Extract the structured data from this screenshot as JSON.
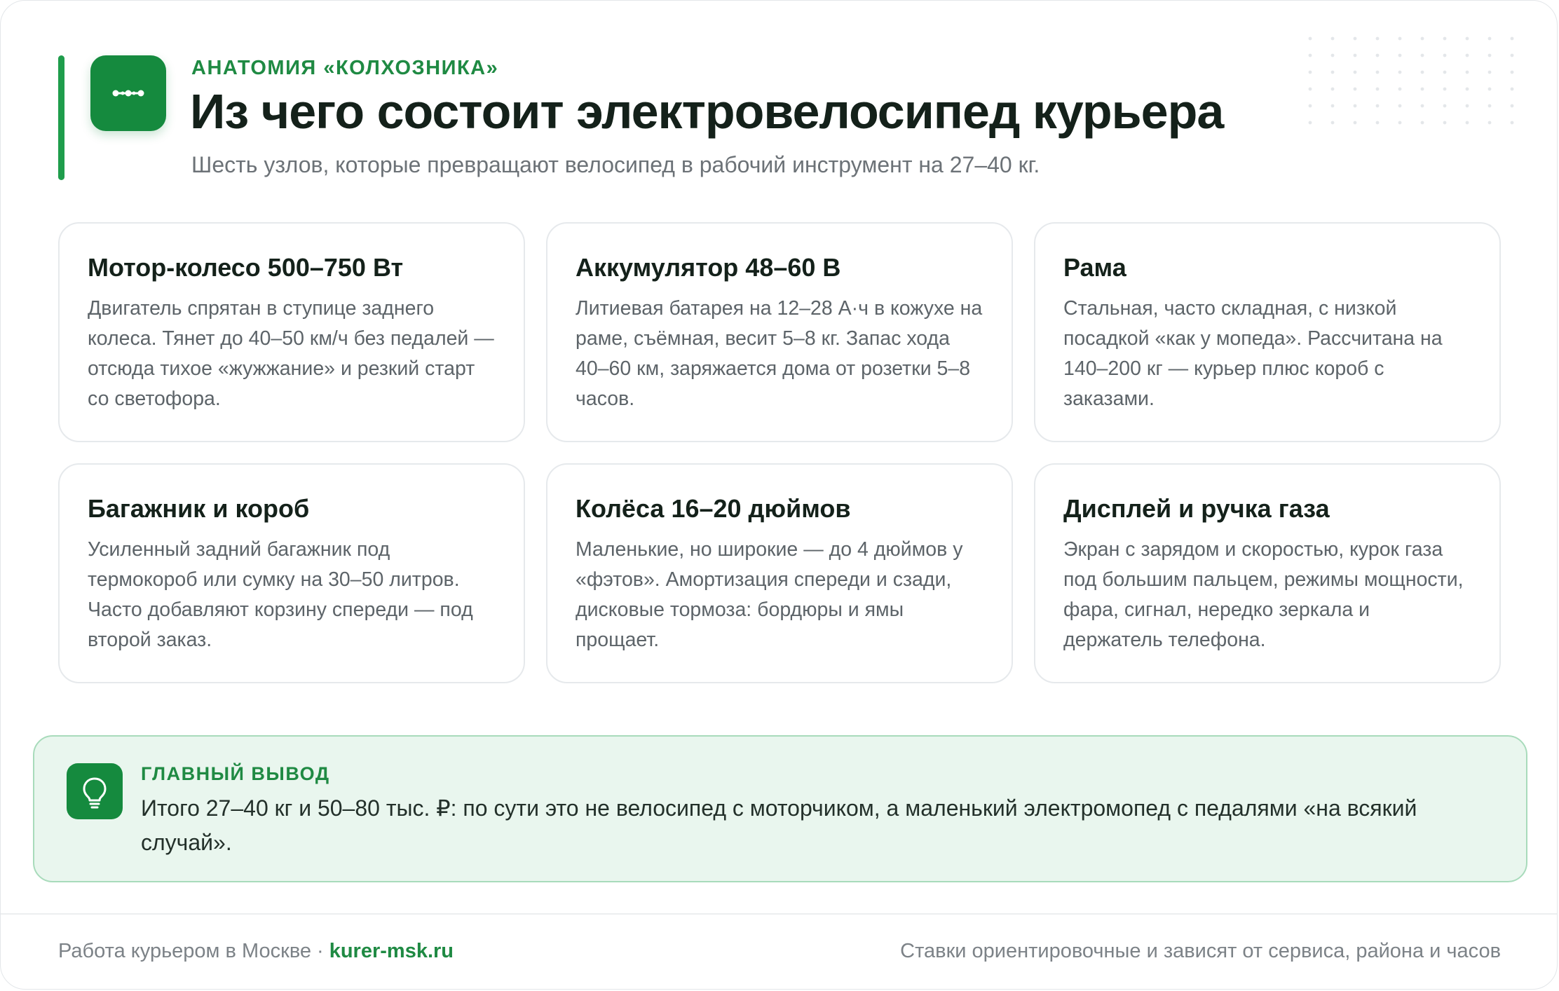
{
  "header": {
    "eyebrow": "АНАТОМИЯ «КОЛХОЗНИКА»",
    "title": "Из чего состоит электровелосипед курьера",
    "subtitle": "Шесть узлов, которые превращают велосипед в рабочий инструмент на 27–40 кг.",
    "logo_icon": "connection-dots-icon"
  },
  "cards": [
    {
      "title": "Мотор-колесо 500–750 Вт",
      "text": "Двигатель спрятан в ступице заднего колеса. Тянет до 40–50 км/ч без педалей — отсюда тихое «жужжание» и резкий старт со светофора."
    },
    {
      "title": "Аккумулятор 48–60 В",
      "text": "Литиевая батарея на 12–28 А·ч в кожухе на раме, съёмная, весит 5–8 кг. Запас хода 40–60 км, заряжается дома от розетки 5–8 часов."
    },
    {
      "title": "Рама",
      "text": "Стальная, часто складная, с низкой посадкой «как у мопеда». Рассчитана на 140–200 кг — курьер плюс короб с заказами."
    },
    {
      "title": "Багажник и короб",
      "text": "Усиленный задний багажник под термокороб или сумку на 30–50 литров. Часто добавляют корзину спереди — под второй заказ."
    },
    {
      "title": "Колёса 16–20 дюймов",
      "text": "Маленькие, но широкие — до 4 дюймов у «фэтов». Амортизация спереди и сзади, дисковые тормоза: бордюры и ямы прощает."
    },
    {
      "title": "Дисплей и ручка газа",
      "text": "Экран с зарядом и скоростью, курок газа под большим пальцем, режимы мощности, фара, сигнал, нередко зеркала и держатель телефона."
    }
  ],
  "callout": {
    "label": "ГЛАВНЫЙ ВЫВОД",
    "text": "Итого 27–40 кг и 50–80 тыс. ₽: по сути это не велосипед с моторчиком, а маленький электромопед с педалями «на всякий случай».",
    "icon": "lightbulb-icon"
  },
  "footer": {
    "left_text": "Работа курьером в Москве",
    "separator": "·",
    "link": "kurer-msk.ru",
    "right_text": "Ставки ориентировочные и зависят от сервиса, района и часов"
  },
  "colors": {
    "accent": "#158a3e",
    "accent_text": "#1f8a43",
    "callout_bg": "#e9f6ee",
    "callout_border": "#a8dbbb",
    "title": "#14211a",
    "muted": "#6c7277"
  }
}
